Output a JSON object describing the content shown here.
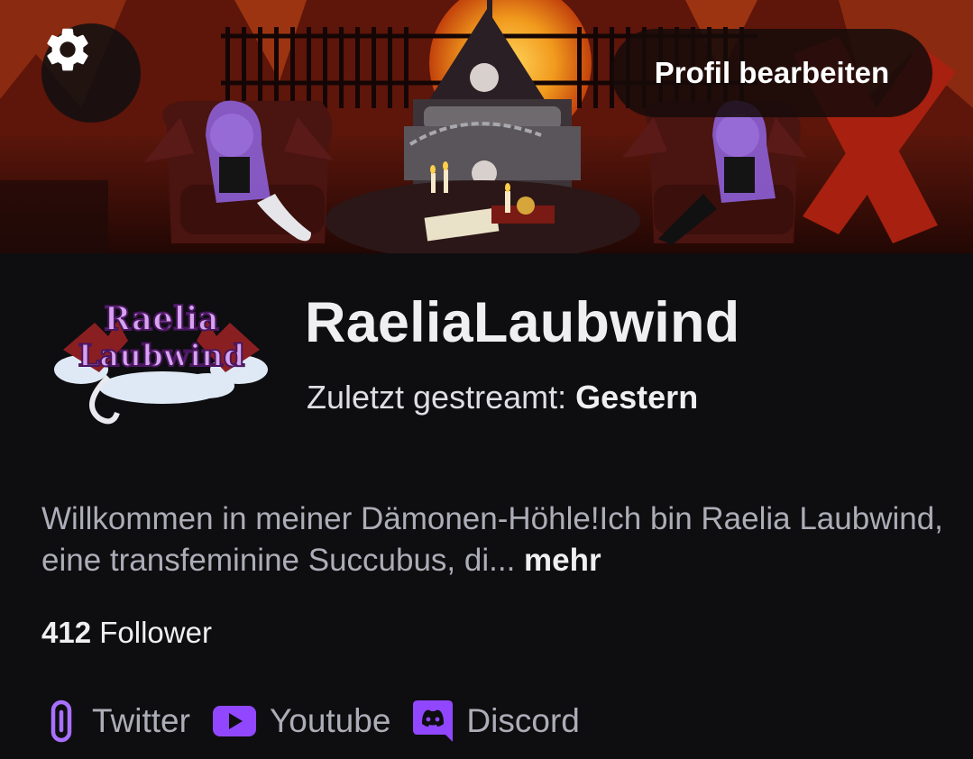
{
  "header": {
    "settings_icon": "gear-icon",
    "edit_profile_label": "Profil bearbeiten"
  },
  "profile": {
    "channel_name": "RaeliaLaubwind",
    "avatar_logo_line1": "Raelia",
    "avatar_logo_line2": "Laubwind",
    "last_stream_label": "Zuletzt gestreamt:",
    "last_stream_value": "Gestern"
  },
  "bio": {
    "text": "Willkommen in meiner Dämonen-Höhle!Ich bin Raelia Laubwind, eine transfeminine Succubus, di...",
    "more_label": "mehr"
  },
  "followers": {
    "count": "412",
    "label": "Follower"
  },
  "socials": [
    {
      "label": "Twitter",
      "icon": "link-icon"
    },
    {
      "label": "Youtube",
      "icon": "youtube-icon"
    },
    {
      "label": "Discord",
      "icon": "discord-icon"
    }
  ],
  "colors": {
    "accent": "#9147ff",
    "background": "#0e0e10",
    "text_primary": "#efeff1",
    "text_secondary": "#adadb8"
  }
}
